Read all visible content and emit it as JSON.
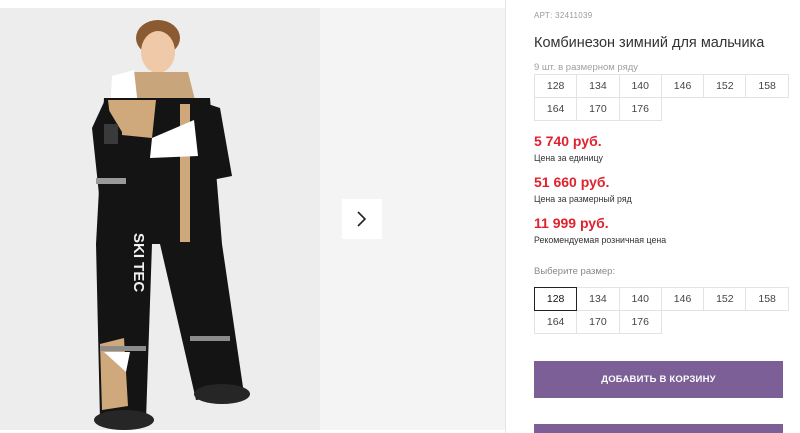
{
  "product": {
    "article": "АРТ: 32411039",
    "title": "Комбинезон зимний для мальчика",
    "set_note": "9 шт. в размерном ряду",
    "set_sizes": [
      "128",
      "134",
      "140",
      "146",
      "152",
      "158",
      "164",
      "170",
      "176"
    ]
  },
  "prices": {
    "unit_price": "5 740 руб.",
    "unit_label": "Цена за единицу",
    "set_price": "51 660 руб.",
    "set_label": "Цена за размерный ряд",
    "rrp_price": "11 999 руб.",
    "rrp_label": "Рекомендуемая розничная цена"
  },
  "size_picker": {
    "label": "Выберите размер:",
    "sizes": [
      "128",
      "134",
      "140",
      "146",
      "152",
      "158",
      "164",
      "170",
      "176"
    ],
    "selected": "128"
  },
  "actions": {
    "add_to_cart": "ДОБАВИТЬ В КОРЗИНУ"
  },
  "photo": {
    "print_text": "SKI TEC"
  },
  "colors": {
    "accent": "#7b5f96",
    "price": "#e0222e"
  }
}
